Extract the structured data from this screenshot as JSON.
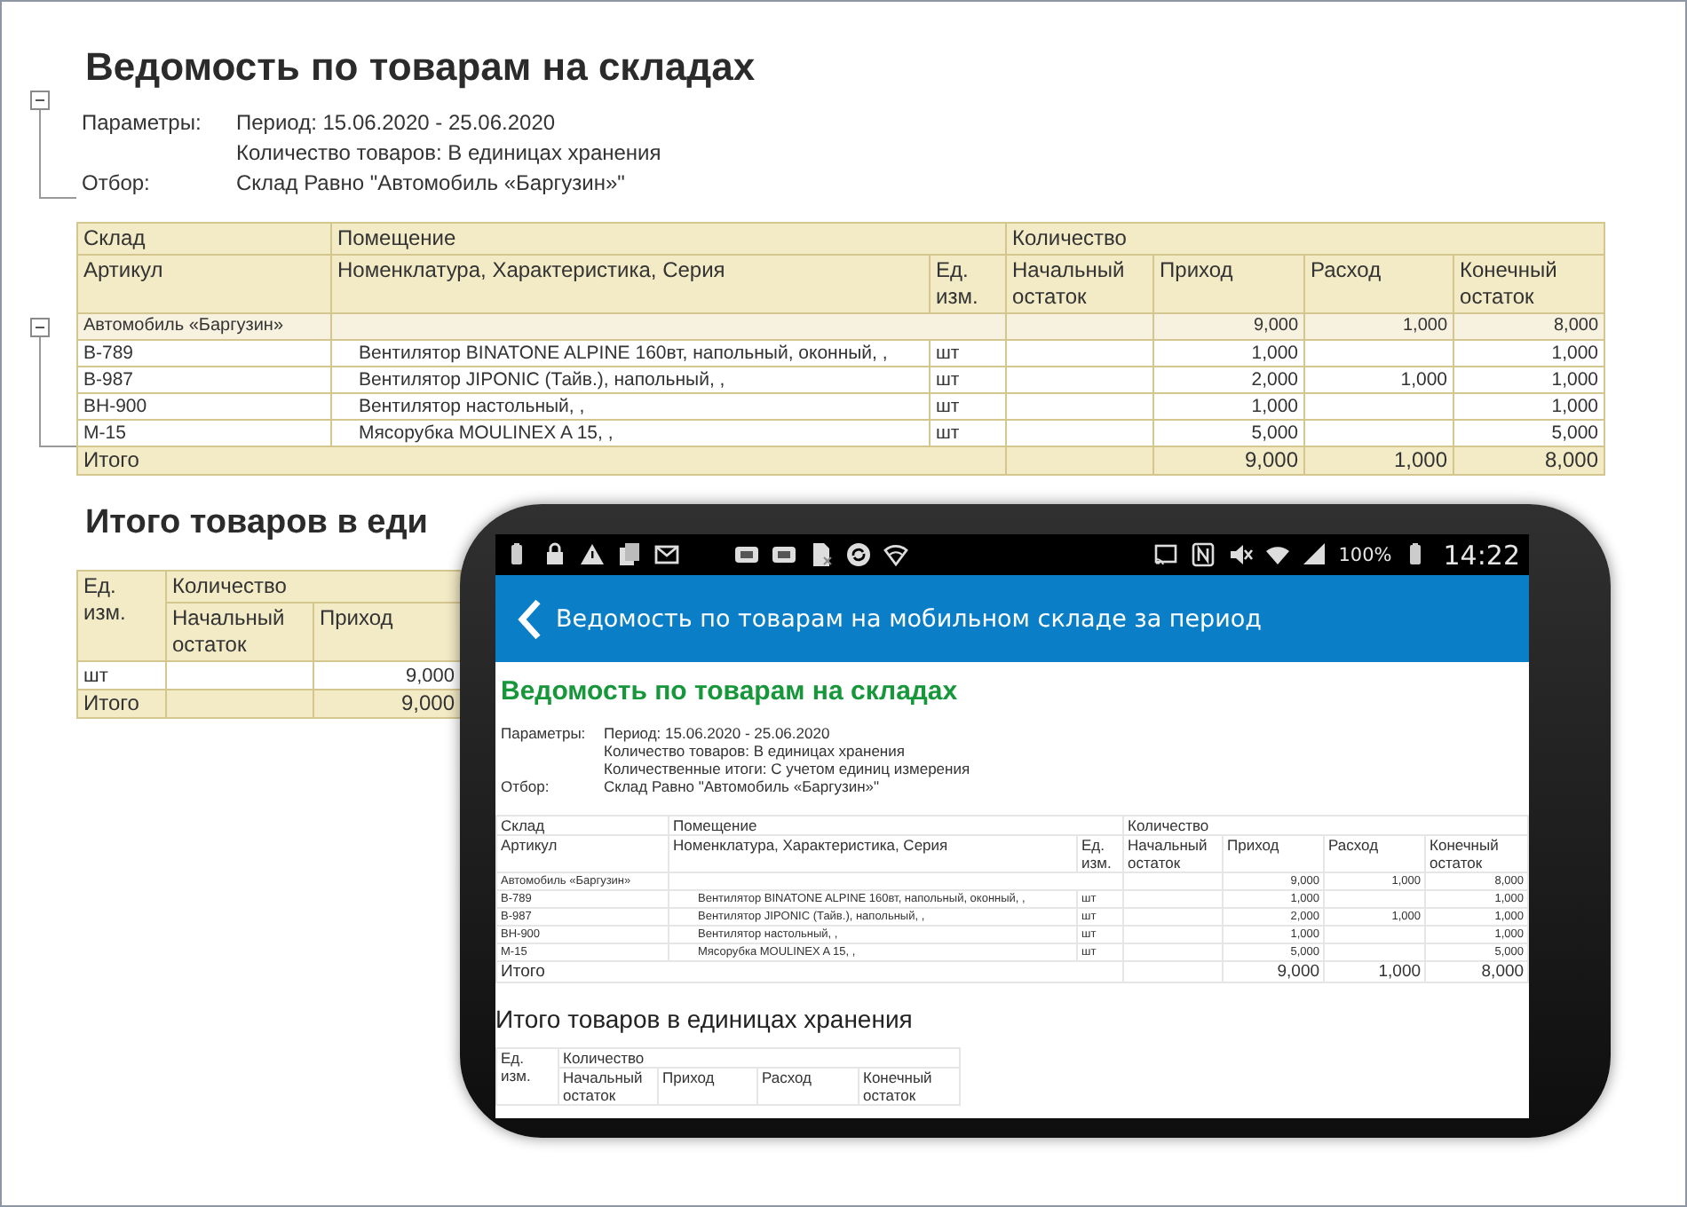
{
  "report": {
    "title": "Ведомость по товарам на складах",
    "params_expanded": true,
    "params": [
      {
        "label": "Параметры:",
        "lines": [
          "Период: 15.06.2020 - 25.06.2020",
          "Количество товаров: В единицах хранения"
        ]
      },
      {
        "label": "Отбор:",
        "lines": [
          "Склад Равно \"Автомобиль «Баргузин»\""
        ]
      }
    ],
    "table": {
      "group_headers": [
        "Склад",
        "Помещение",
        "Количество"
      ],
      "columns": [
        "Артикул",
        "Номенклатура, Характеристика, Серия",
        "Ед. изм.",
        "Начальный остаток",
        "Приход",
        "Расход",
        "Конечный остаток"
      ],
      "group": {
        "name": "Автомобиль «Баргузин»",
        "expanded": true,
        "receipt": "9,000",
        "expense": "1,000",
        "end": "8,000"
      },
      "rows": [
        {
          "article": "B-789",
          "name": "Вентилятор BINATONE ALPINE 160вт, напольный, оконный, ,",
          "unit": "шт",
          "receipt": "1,000",
          "end": "1,000"
        },
        {
          "article": "B-987",
          "name": "Вентилятор JIPONIC (Тайв.), напольный, ,",
          "unit": "шт",
          "receipt": "2,000",
          "expense": "1,000",
          "end": "1,000"
        },
        {
          "article": "BH-900",
          "name": "Вентилятор настольный, ,",
          "unit": "шт",
          "receipt": "1,000",
          "end": "1,000"
        },
        {
          "article": "M-15",
          "name": "Мясорубка MOULINEX  A 15, ,",
          "unit": "шт",
          "receipt": "5,000",
          "end": "5,000"
        }
      ],
      "total": {
        "label": "Итого",
        "receipt": "9,000",
        "expense": "1,000",
        "end": "8,000"
      }
    },
    "summary_title": "Итого товаров в еди",
    "summary": {
      "unit_header": "Ед. изм.",
      "group_header": "Количество",
      "columns": [
        "Начальный остаток",
        "Приход"
      ],
      "rows": [
        {
          "unit": "шт",
          "receipt": "9,000"
        }
      ],
      "total": {
        "label": "Итого",
        "receipt": "9,000"
      }
    }
  },
  "phone": {
    "status_bar": {
      "battery": "100%",
      "time": "14:22"
    },
    "header": {
      "title": "Ведомость по товарам на мобильном складе за период"
    },
    "report": {
      "title": "Ведомость по товарам на складах",
      "params": [
        {
          "label": "Параметры:",
          "lines": [
            "Период: 15.06.2020 - 25.06.2020",
            "Количество товаров: В единицах хранения",
            "Количественные итоги: С учетом единиц измерения"
          ]
        },
        {
          "label": "Отбор:",
          "lines": [
            "Склад Равно \"Автомобиль «Баргузин»\""
          ]
        }
      ],
      "table": {
        "group_headers": [
          "Склад",
          "Помещение",
          "Количество"
        ],
        "columns": [
          "Артикул",
          "Номенклатура, Характеристика, Серия",
          "Ед. изм.",
          "Начальный остаток",
          "Приход",
          "Расход",
          "Конечный остаток"
        ],
        "group": {
          "name": "Автомобиль «Баргузин»",
          "receipt": "9,000",
          "expense": "1,000",
          "end": "8,000"
        },
        "rows": [
          {
            "article": "B-789",
            "name": "Вентилятор BINATONE ALPINE 160вт, напольный, оконный, ,",
            "unit": "шт",
            "receipt": "1,000",
            "end": "1,000"
          },
          {
            "article": "B-987",
            "name": "Вентилятор JIPONIC (Тайв.), напольный, ,",
            "unit": "шт",
            "receipt": "2,000",
            "expense": "1,000",
            "end": "1,000"
          },
          {
            "article": "BH-900",
            "name": "Вентилятор настольный, ,",
            "unit": "шт",
            "receipt": "1,000",
            "end": "1,000"
          },
          {
            "article": "M-15",
            "name": "Мясорубка MOULINEX A 15, ,",
            "unit": "шт",
            "receipt": "5,000",
            "end": "5,000"
          }
        ],
        "total": {
          "label": "Итого",
          "receipt": "9,000",
          "expense": "1,000",
          "end": "8,000"
        }
      },
      "summary_title": "Итого товаров в единицах хранения",
      "summary": {
        "unit_header": "Ед. изм.",
        "group_header": "Количество",
        "columns": [
          "Начальный остаток",
          "Приход",
          "Расход",
          "Конечный остаток"
        ]
      }
    }
  }
}
